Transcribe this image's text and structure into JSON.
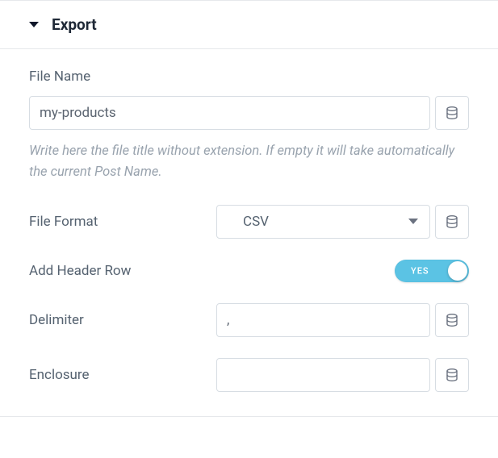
{
  "panel": {
    "title": "Export"
  },
  "file_name": {
    "label": "File Name",
    "value": "my-products",
    "helper": "Write here the file title without extension. If empty it will take automatically the current Post Name."
  },
  "file_format": {
    "label": "File Format",
    "selected": "CSV"
  },
  "header_row": {
    "label": "Add Header Row",
    "toggle_text": "YES"
  },
  "delimiter": {
    "label": "Delimiter",
    "value": ","
  },
  "enclosure": {
    "label": "Enclosure",
    "value": ""
  }
}
